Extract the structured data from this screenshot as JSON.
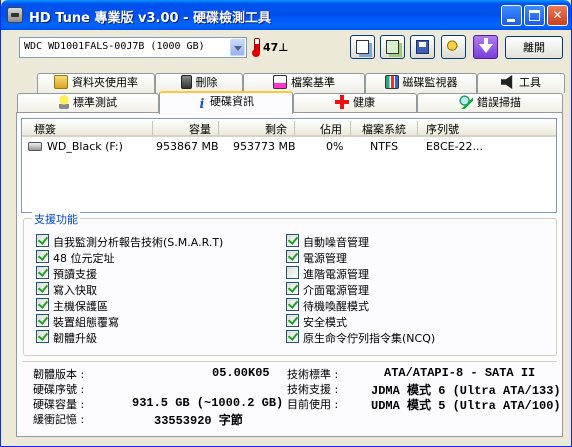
{
  "window": {
    "title": "HD Tune 專業版 v3.00 - 硬碟檢測工具"
  },
  "toolbar": {
    "drive_selected": "WDC WD1001FALS-00J7B (1000 GB)",
    "temperature": "47⊥",
    "exit_label": "離開"
  },
  "tabs_top": [
    {
      "label": "資料夾使用率",
      "icon": "folder-icon"
    },
    {
      "label": "刪除",
      "icon": "trash-icon"
    },
    {
      "label": "檔案基準",
      "icon": "file-benchmark-icon"
    },
    {
      "label": "磁碟監視器",
      "icon": "disk-monitor-icon"
    },
    {
      "label": "工具",
      "icon": "speaker-icon"
    }
  ],
  "tabs_bottom": [
    {
      "label": "標準測試",
      "icon": "bulb-icon"
    },
    {
      "label": "硬碟資訊",
      "icon": "info-icon",
      "active": true
    },
    {
      "label": "健康",
      "icon": "health-cross-icon"
    },
    {
      "label": "錯誤掃描",
      "icon": "magnifier-icon"
    }
  ],
  "volumes": {
    "headers": [
      "標簽",
      "容量",
      "剩余",
      "佔用",
      "檔案系統",
      "序列號"
    ],
    "rows": [
      [
        "WD_Black (F:)",
        "953867 MB",
        "953773 MB",
        "0%",
        "NTFS",
        "E8CE-22..."
      ]
    ]
  },
  "features": {
    "title": "支援功能",
    "left": [
      {
        "label": "自我監測分析報告技術(S.M.A.R.T)",
        "checked": true
      },
      {
        "label": "48 位元定址",
        "checked": true
      },
      {
        "label": "預讀支援",
        "checked": true
      },
      {
        "label": "寫入快取",
        "checked": true
      },
      {
        "label": "主機保護區",
        "checked": true
      },
      {
        "label": "裝置組態覆寫",
        "checked": true
      },
      {
        "label": "韌體升級",
        "checked": true
      }
    ],
    "right": [
      {
        "label": "自動噪音管理",
        "checked": true
      },
      {
        "label": "電源管理",
        "checked": true
      },
      {
        "label": "進階電源管理",
        "checked": false
      },
      {
        "label": "介面電源管理",
        "checked": true
      },
      {
        "label": "待機喚醒模式",
        "checked": true
      },
      {
        "label": "安全模式",
        "checked": true
      },
      {
        "label": "原生命令佇列指令集(NCQ)",
        "checked": true
      }
    ]
  },
  "details": {
    "firmware_label": "韌體版本 :",
    "firmware_value": "05.00K05",
    "serial_label": "硬碟序號 :",
    "serial_value": "",
    "capacity_label": "硬碟容量 :",
    "capacity_value": "931.5 GB (~1000.2 GB)",
    "cache_label": "緩衝記憶 :",
    "cache_value": "33553920 字節",
    "standard_label": "技術標準 :",
    "standard_value": "ATA/ATAPI-8 - SATA II",
    "support_label": "技術支援 :",
    "support_value": "JDMA 模式 6 (Ultra ATA/133)",
    "active_label": "目前使用 :",
    "active_value": "UDMA 模式 5 (Ultra ATA/100)"
  }
}
